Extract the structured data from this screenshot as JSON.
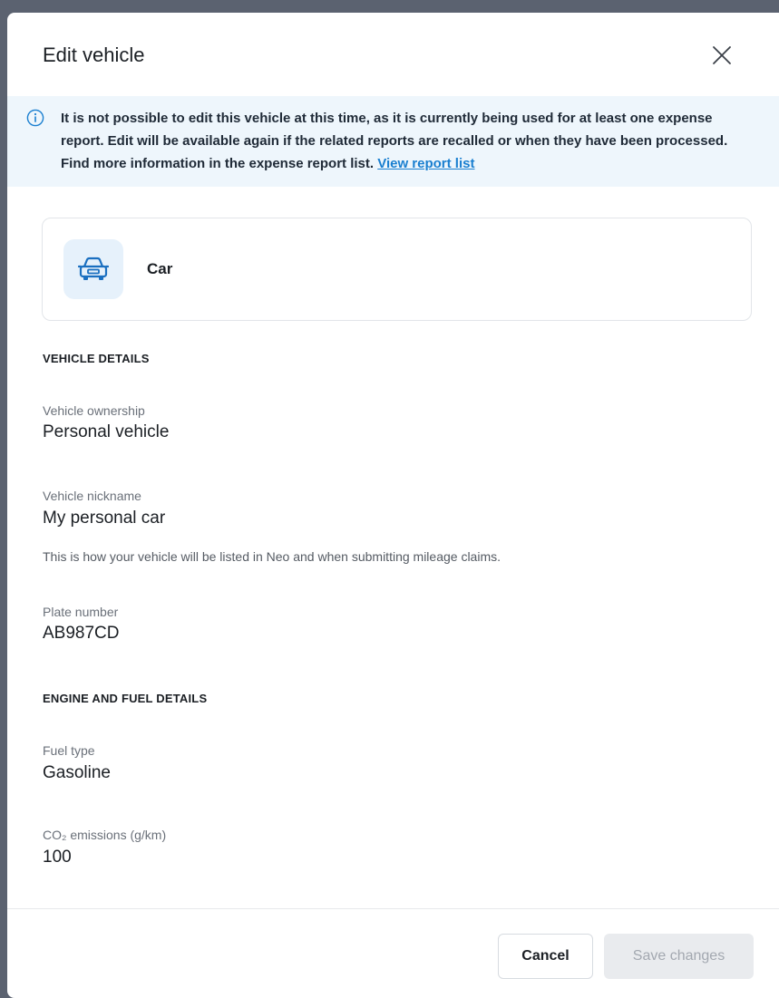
{
  "dialog": {
    "title": "Edit vehicle",
    "close_icon": "close-icon"
  },
  "banner": {
    "icon": "info-icon",
    "text": "It is not possible to edit this vehicle at this time, as it is currently being used for at least one expense report. Edit will be available again if the related reports are recalled or when they have been processed. Find more information in the expense report list.",
    "link_label": "View report list",
    "link_color": "#1a7fd0",
    "background": "#eef6fc"
  },
  "vehicle_type": {
    "icon": "car-icon",
    "label": "Car",
    "icon_color": "#1a6fc0"
  },
  "vehicle_details": {
    "heading": "VEHICLE DETAILS",
    "ownership_label": "Vehicle ownership",
    "ownership_value": "Personal vehicle",
    "nickname_label": "Vehicle nickname",
    "nickname_value": "My personal car",
    "nickname_help": "This is how your vehicle will be listed in Neo and when submitting mileage claims.",
    "plate_label": "Plate number",
    "plate_value": "AB987CD"
  },
  "engine_details": {
    "heading": "ENGINE AND FUEL DETAILS",
    "fuel_label": "Fuel type",
    "fuel_value": "Gasoline",
    "emissions_label": "CO₂ emissions (g/km)",
    "emissions_value": "100"
  },
  "footer": {
    "cancel_label": "Cancel",
    "save_label": "Save changes",
    "save_disabled": true
  }
}
